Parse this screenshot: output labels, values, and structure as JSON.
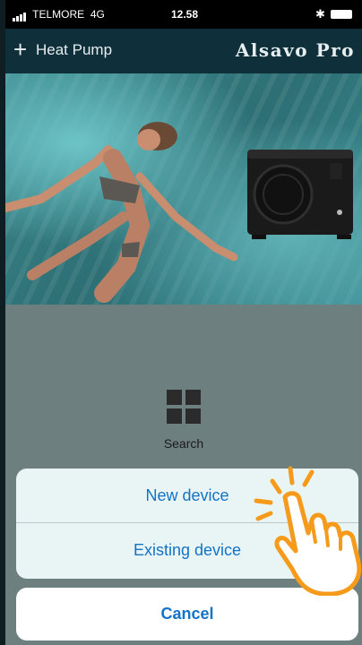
{
  "status_bar": {
    "carrier": "TELMORE",
    "network": "4G",
    "time": "12.58"
  },
  "nav_bar": {
    "add_icon": "plus-icon",
    "title": "Heat Pump",
    "brand": "Alsavo Pro"
  },
  "search": {
    "label": "Search",
    "icon": "grid-icon"
  },
  "action_sheet": {
    "options": [
      "New device",
      "Existing device"
    ],
    "cancel_label": "Cancel"
  },
  "colors": {
    "nav_bg": "#0f2f3b",
    "action_text": "#1373c7",
    "sheet_bg": "#e9f4f5",
    "hand": "#f59a1a"
  }
}
